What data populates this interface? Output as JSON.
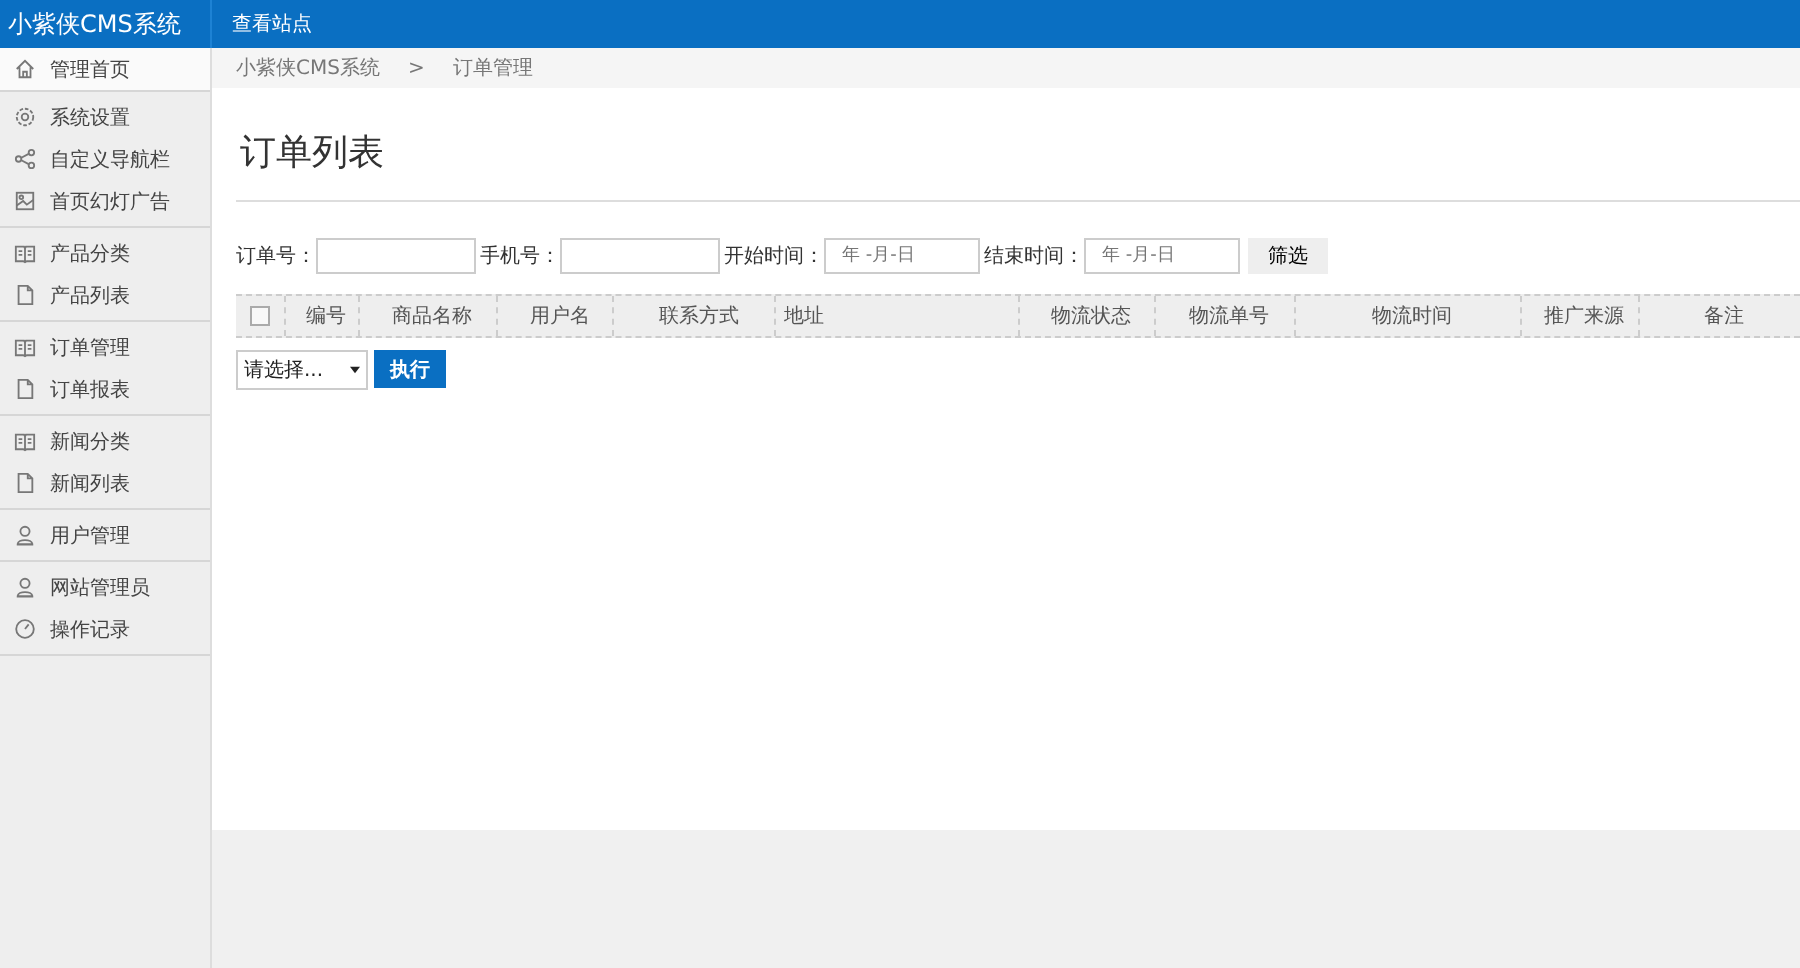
{
  "header": {
    "logo": "小紫侠CMS系统",
    "link": "查看站点"
  },
  "sidebar": {
    "groups": [
      {
        "items": [
          {
            "label": "管理首页",
            "kind": "home",
            "selected": true
          }
        ]
      },
      {
        "items": [
          {
            "label": "系统设置",
            "kind": "gear",
            "selected": false
          },
          {
            "label": "自定义导航栏",
            "kind": "share",
            "selected": false
          },
          {
            "label": "首页幻灯广告",
            "kind": "picture",
            "selected": false
          }
        ]
      },
      {
        "items": [
          {
            "label": "产品分类",
            "kind": "book",
            "selected": false
          },
          {
            "label": "产品列表",
            "kind": "file",
            "selected": false
          }
        ]
      },
      {
        "items": [
          {
            "label": "订单管理",
            "kind": "book",
            "selected": false
          },
          {
            "label": "订单报表",
            "kind": "file",
            "selected": false
          }
        ]
      },
      {
        "items": [
          {
            "label": "新闻分类",
            "kind": "book",
            "selected": false
          },
          {
            "label": "新闻列表",
            "kind": "file",
            "selected": false
          }
        ]
      },
      {
        "items": [
          {
            "label": "用户管理",
            "kind": "user",
            "selected": false
          }
        ]
      },
      {
        "items": [
          {
            "label": "网站管理员",
            "kind": "user",
            "selected": false
          },
          {
            "label": "操作记录",
            "kind": "clock",
            "selected": false
          }
        ]
      }
    ]
  },
  "breadcrumb": [
    "小紫侠CMS系统",
    ">",
    "订单管理"
  ],
  "page_title": "订单列表",
  "filters": [
    {
      "label": "订单号：",
      "kind": "text"
    },
    {
      "label": "手机号：",
      "kind": "text"
    },
    {
      "label": "开始时间：",
      "kind": "date",
      "placeholder": "年 -月-日"
    },
    {
      "label": "结束时间：",
      "kind": "date",
      "placeholder": "年 -月-日"
    }
  ],
  "filter_button": "筛选",
  "table": {
    "select_all": {
      "checked": false
    },
    "columns": [
      "编号",
      "商品名称",
      "用户名",
      "联系方式",
      "地址",
      "物流状态",
      "物流单号",
      "物流时间",
      "推广来源",
      "备注"
    ]
  },
  "bulk": {
    "select": "请选择...",
    "button": "执行"
  }
}
